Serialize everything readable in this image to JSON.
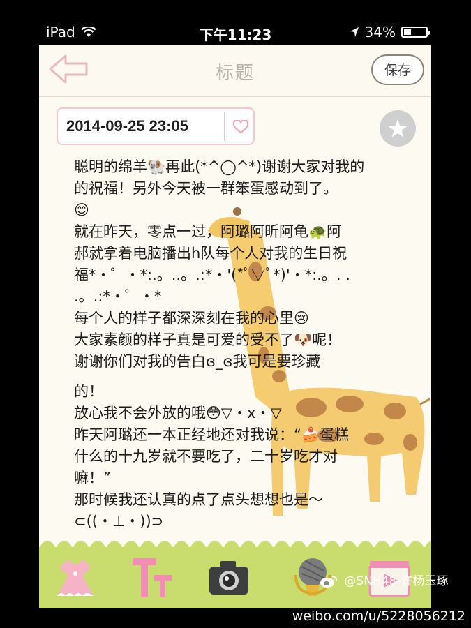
{
  "status_bar": {
    "device": "iPad",
    "time": "下午11:23",
    "battery": "34%",
    "battery_level": 0.34
  },
  "nav": {
    "title": "标题",
    "save_label": "保存"
  },
  "entry": {
    "date": "2014-09-25 23:05",
    "lines": [
      "聪明的绵羊🐏再此(*^◯^*)谢谢大家对我的",
      "的祝福！另外今天被一群笨蛋感动到了。",
      "😊",
      "就在昨天，零点一过，阿璐阿昕阿龟🐢阿",
      "郝就拿着电脑播出h队每个人对我的生日祝",
      "福*・゜・*:.。..。.:*・'(*ﾟ▽ﾟ*)'・*:.。. .",
      ".。.:*・゜・*",
      "每个人的样子都深深刻在我的心里😢",
      "大家素颜的样子真是可爱的受不了🐶呢！",
      "谢谢你们对我的告白ɞ_ɞ我可是要珍藏",
      "的！",
      "放心我不会外放的哦😳▽・x・▽",
      "昨天阿璐还一本正经地还对我说：“🍰蛋糕",
      "什么的十九岁就不要吃了，二十岁吃才对",
      "嘛！”",
      "那时候我还认真的点了点头想想也是～",
      "⊂((・⊥・))⊃"
    ]
  },
  "watermark": {
    "handle": "@SNH48-许杨玉琢",
    "url": "weibo.com/u/5228056212"
  },
  "colors": {
    "toolbar": "#c9dc6e",
    "accent_pink": "#f2c8ce",
    "paper": "#fdfbf1"
  },
  "icons": [
    "wifi-icon",
    "location-arrow-icon",
    "battery-icon",
    "back-arrow-icon",
    "heart-icon",
    "star-icon",
    "dress-icon",
    "text-style-icon",
    "camera-icon",
    "microphone-icon",
    "video-icon",
    "weibo-logo-icon"
  ]
}
